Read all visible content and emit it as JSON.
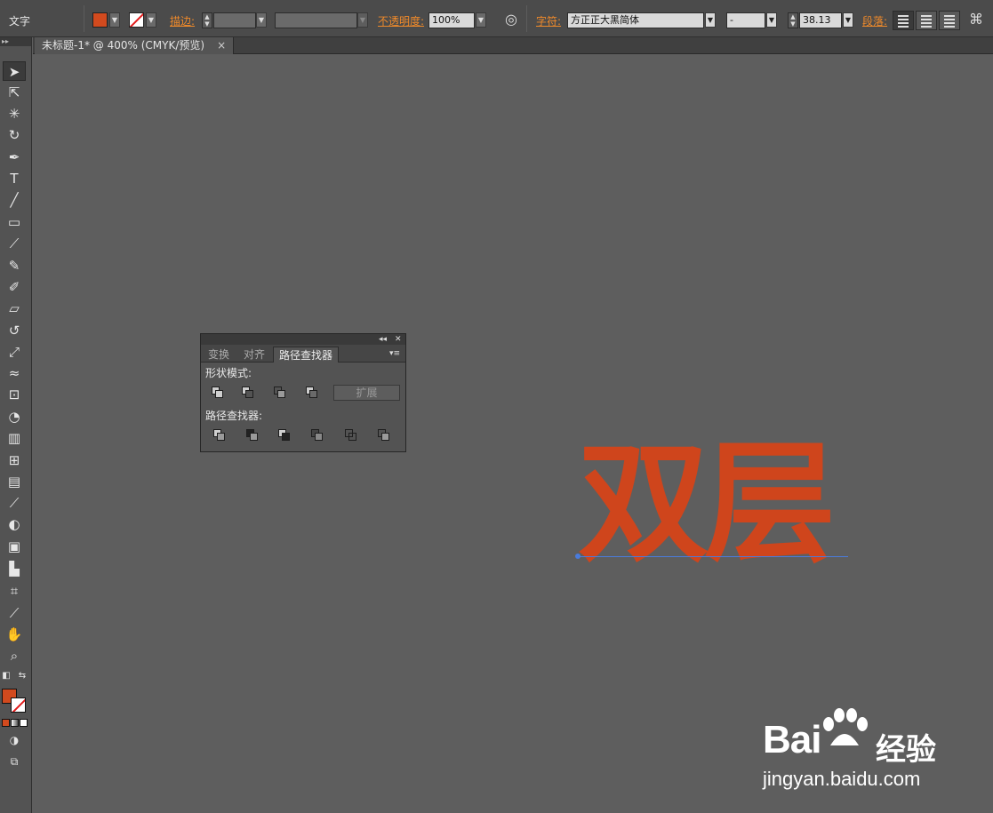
{
  "control_bar": {
    "tool_name": "文字",
    "stroke_label": "描边:",
    "opacity_label": "不透明度:",
    "opacity_value": "100%",
    "character_label": "字符:",
    "font_family": "方正正大黑简体",
    "font_style": "-",
    "font_size": "38.13",
    "paragraph_label": "段落:",
    "fill_color": "#d24a1e"
  },
  "document_tab": {
    "title": "未标题-1* @ 400% (CMYK/预览)",
    "close": "×"
  },
  "pathfinder_panel": {
    "tabs": [
      "变换",
      "对齐",
      "路径查找器"
    ],
    "active_tab": "路径查找器",
    "shape_modes_label": "形状模式:",
    "pathfinders_label": "路径查找器:",
    "expand_label": "扩展"
  },
  "artwork": {
    "text": "双层",
    "color": "#cf451c"
  },
  "watermark": {
    "logo": "Bai",
    "logo_du": "du",
    "product": "经验",
    "url": "jingyan.baidu.com"
  },
  "toolbox": {
    "tools": [
      "selection-tool",
      "direct-selection-tool",
      "magic-wand-tool",
      "lasso-tool",
      "pen-tool",
      "type-tool",
      "line-tool",
      "rectangle-tool",
      "paintbrush-tool",
      "pencil-tool",
      "blob-brush-tool",
      "eraser-tool",
      "rotate-tool",
      "scale-tool",
      "width-tool",
      "free-transform-tool",
      "shape-builder-tool",
      "perspective-grid-tool",
      "mesh-tool",
      "gradient-tool",
      "eyedropper-tool",
      "blend-tool",
      "symbol-sprayer-tool",
      "column-graph-tool",
      "artboard-tool",
      "slice-tool",
      "hand-tool",
      "zoom-tool"
    ]
  }
}
